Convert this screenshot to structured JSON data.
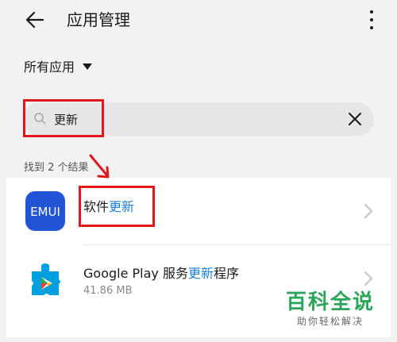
{
  "header": {
    "title": "应用管理"
  },
  "filter": {
    "label": "所有应用"
  },
  "search": {
    "value": "更新"
  },
  "results": {
    "count_text": "找到 2 个结果"
  },
  "apps": [
    {
      "name_pre": "软件",
      "name_hl": "更新",
      "name_post": "",
      "size": "",
      "icon": "emui-icon"
    },
    {
      "name_pre": "Google Play 服务",
      "name_hl": "更新",
      "name_post": "程序",
      "size": "41.86 MB",
      "icon": "google-play-services-icon"
    }
  ],
  "watermark": {
    "main": "百科全说",
    "sub": "助你轻松解决"
  },
  "icon_text": {
    "emui": "EMUI"
  },
  "colors": {
    "highlight": "#1a7fd8",
    "annotation": "#e0161b",
    "watermark": "#2aa55a",
    "emui_icon": "#2255d6"
  }
}
